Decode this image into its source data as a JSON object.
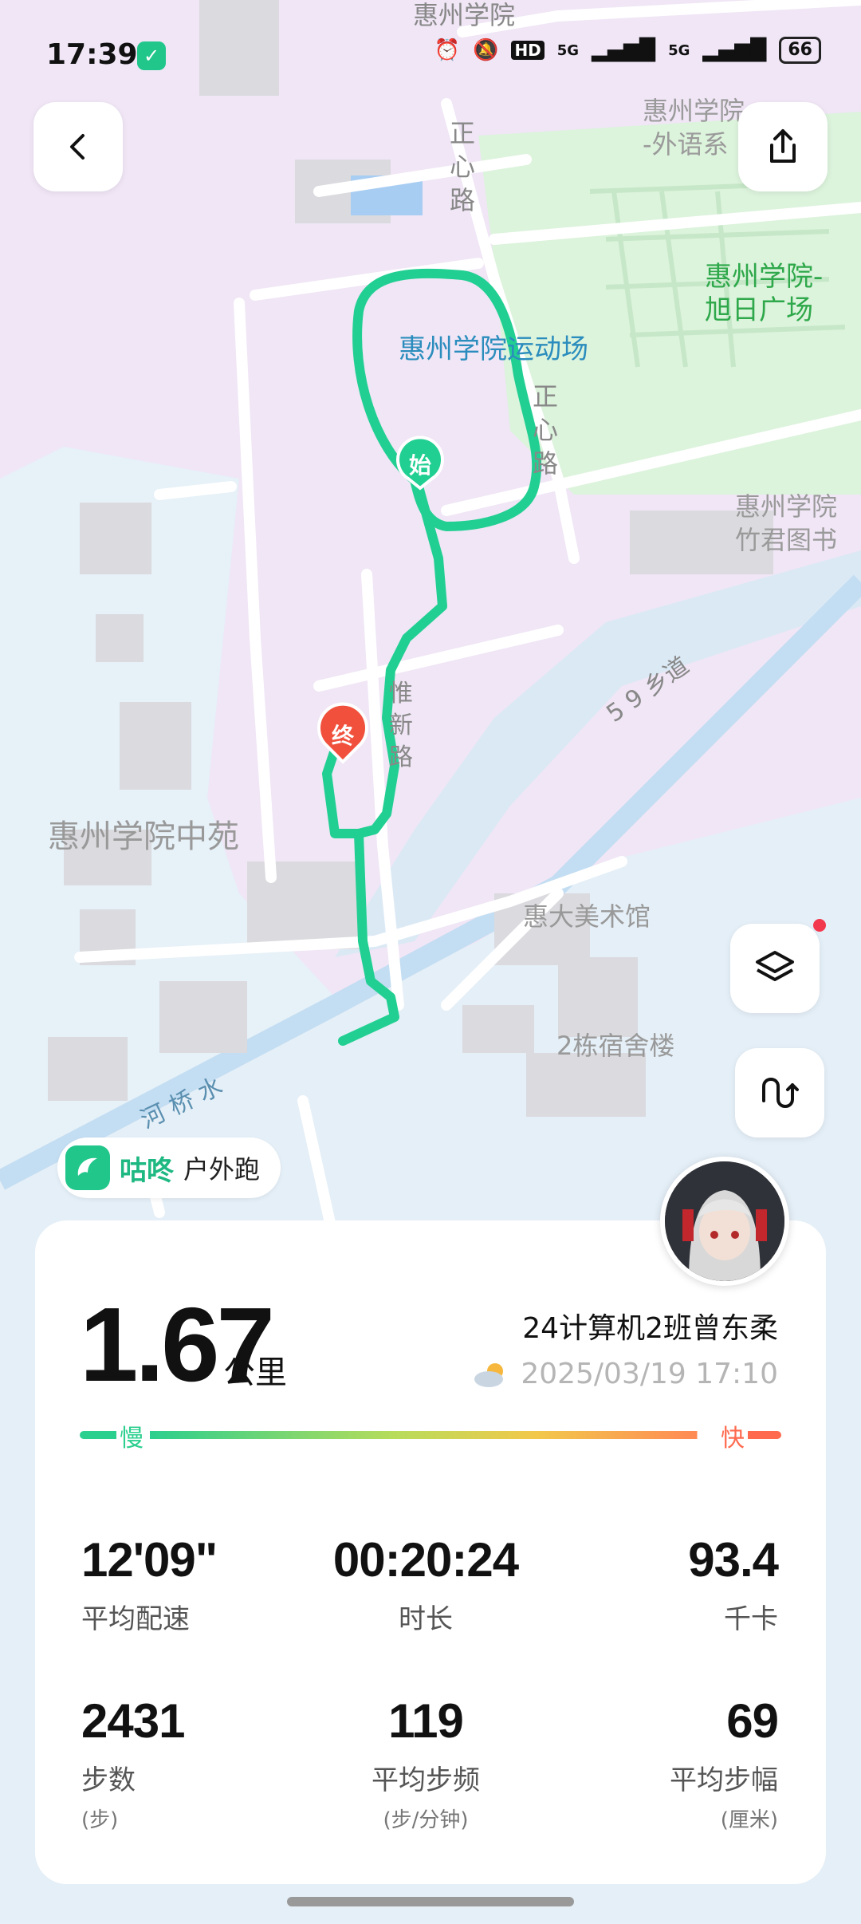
{
  "status_bar": {
    "time": "17:39",
    "network_5g_1": "5G",
    "network_5g_2": "5G",
    "hd": "HD",
    "battery": "66"
  },
  "map": {
    "labels": {
      "top": "惠州学院",
      "foreign": "惠州学院\n-外语系",
      "zhengxin1": "正\n心\n路",
      "xuri": "惠州学院-\n旭日广场",
      "stadium": "惠州学院运动场",
      "zhengxin2": "正\n心\n路",
      "library": "惠州学院\n竹君图书",
      "xiang59": "5 9 乡道",
      "zhongyuan": "惠州学院中苑",
      "museum": "惠大美术馆",
      "dorm2": "2栋宿舍楼",
      "river": "河 桥 水",
      "huaxin": "惟\n新\n路"
    },
    "start_marker": "始",
    "end_marker": "终"
  },
  "brand": {
    "name": "咕咚",
    "sport": "户外跑"
  },
  "summary": {
    "distance": "1.67",
    "distance_unit": "公里",
    "user": "24计算机2班曾东柔",
    "datetime": "2025/03/19 17:10",
    "slow": "慢",
    "fast": "快"
  },
  "stats": {
    "pace": {
      "value": "12'09\"",
      "label": "平均配速"
    },
    "duration": {
      "value": "00:20:24",
      "label": "时长"
    },
    "calories": {
      "value": "93.4",
      "label": "千卡"
    },
    "steps": {
      "value": "2431",
      "label": "步数",
      "unit": "(步)"
    },
    "cadence": {
      "value": "119",
      "label": "平均步频",
      "unit": "(步/分钟)"
    },
    "stride": {
      "value": "69",
      "label": "平均步幅",
      "unit": "(厘米)"
    }
  },
  "colors": {
    "accent": "#21c68b",
    "route": "#22cf92",
    "end_marker": "#f0503c"
  }
}
